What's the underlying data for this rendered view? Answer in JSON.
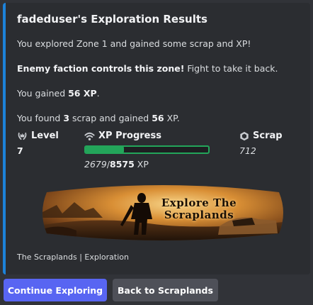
{
  "embed": {
    "title": "fadeduser's Exploration Results",
    "intro": "You explored Zone 1 and gained some scrap and XP!",
    "enemy_bold": "Enemy faction controls this zone!",
    "enemy_rest": " Fight to take it back.",
    "xp_line": {
      "prefix": "You gained ",
      "amount": "56 XP",
      "suffix": "."
    },
    "scrap_line": {
      "p1": "You found ",
      "scrap": "3",
      "p2": " scrap and gained ",
      "xp": "56",
      "p3": " XP."
    },
    "accent_color": "#1d82d9",
    "fields": {
      "level": {
        "name": "Level",
        "value": "7",
        "icon": "crown-laurel-icon"
      },
      "xp_progress": {
        "name": "XP Progress",
        "icon": "wifi-signal-icon",
        "current": "2679",
        "separator": "/",
        "total": "8575",
        "unit": " XP",
        "fraction": 0.31,
        "bar_color": "#23a55a"
      },
      "scrap": {
        "name": "Scrap",
        "value": "712",
        "icon": "scrap-cube-icon"
      }
    },
    "banner": {
      "line1": "Explore The",
      "line2": "Scraplands"
    },
    "footer": "The Scraplands | Exploration"
  },
  "buttons": {
    "continue": "Continue Exploring",
    "back": "Back to Scraplands"
  }
}
